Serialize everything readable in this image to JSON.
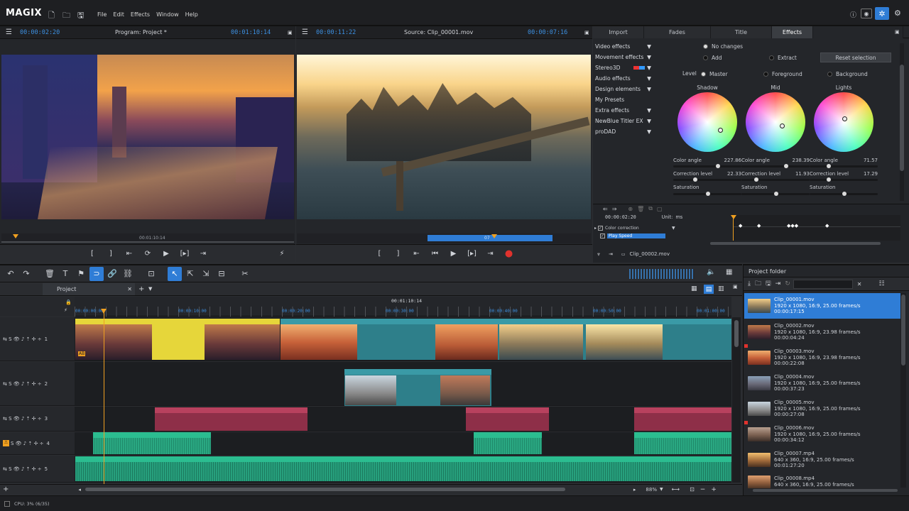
{
  "app": {
    "logo": "MAGIX",
    "menu": [
      "File",
      "Edit",
      "Effects",
      "Window",
      "Help"
    ]
  },
  "program_monitor": {
    "timecode_left": "00:00:02:20",
    "title": "Program: Project *",
    "timecode_right": "00:01:10:14",
    "scrub_time": "00:01:10:14"
  },
  "source_monitor": {
    "timecode_left": "00:00:11:22",
    "title": "Source: Clip_00001.mov",
    "timecode_right": "00:00:07:16",
    "scrub_label": "07"
  },
  "effects_panel": {
    "tabs": [
      "Import",
      "Fades",
      "Title",
      "Effects"
    ],
    "active_tab": "Effects",
    "categories": [
      "Video effects",
      "Movement effects",
      "Stereo3D",
      "Audio effects",
      "Design elements",
      "My Presets",
      "Extra effects",
      "NewBlue Titler EX",
      "proDAD"
    ],
    "options": {
      "no_changes": "No changes",
      "add": "Add",
      "extract": "Extract",
      "reset": "Reset selection",
      "level": "Level",
      "master": "Master",
      "foreground": "Foreground",
      "background": "Background"
    },
    "wheels": [
      {
        "name": "Shadow",
        "angle_label": "Color angle",
        "angle": "227.86",
        "level_label": "Correction level",
        "level": "22.33",
        "sat_label": "Saturation"
      },
      {
        "name": "Mid",
        "angle_label": "Color angle",
        "angle": "238.39",
        "level_label": "Correction level",
        "level": "11.93",
        "sat_label": "Saturation"
      },
      {
        "name": "Lights",
        "angle_label": "Color angle",
        "angle": "71.57",
        "level_label": "Correction level",
        "level": "17.29",
        "sat_label": "Saturation"
      }
    ],
    "keyframe_time": "00:00:02:20",
    "units_label": "Unit:",
    "units_value": "ms",
    "kf_tracks": [
      "Color correction",
      "Play Speed"
    ],
    "clip_name": "Clip_00002.mov"
  },
  "timeline": {
    "tab": "Project",
    "ruler_center": "00:01:10:14",
    "ruler_marks": [
      "00:00:00:00",
      "00:00:10:00",
      "00:00:20:00",
      "00:00:30:00",
      "00:00:40:00",
      "00:00:50:00",
      "00:01:00:00"
    ],
    "zoom": "88%",
    "track_numbers": [
      "1",
      "2",
      "3",
      "4",
      "5"
    ],
    "clips": {
      "t1_yellow": "Clip_00002.mov  75   Color correction",
      "t1_b": "Clip_00003.mov",
      "t1_c": "Clip_00001.mov  75",
      "t2": "Clip_00008.mov",
      "t3_a": "Title   X-pos   Y-pos   Anti cropping",
      "t3_b": "Title   X-pos   Y-pos   Anti ...",
      "t3_c": "Title   X-pos   Y-pos   Anti cropping",
      "t4_a": "Voiceover.wav  75",
      "t4_b": "Voiceover.wav",
      "t4_c": "Voiceover.wav  75",
      "t5": "This Way.wav"
    },
    "clip_badge": "AB"
  },
  "project_folder": {
    "title": "Project folder",
    "items": [
      {
        "name": "Clip_00001.mov",
        "format": "1920 x 1080, 16:9, 25.00 frames/s",
        "duration": "00:00:17:15"
      },
      {
        "name": "Clip_00002.mov",
        "format": "1920 x 1080, 16:9, 23.98 frames/s",
        "duration": "00:00:04:24"
      },
      {
        "name": "Clip_00003.mov",
        "format": "1920 x 1080, 16:9, 23.98 frames/s",
        "duration": "00:00:22:08"
      },
      {
        "name": "Clip_00004.mov",
        "format": "1920 x 1080, 16:9, 25.00 frames/s",
        "duration": "00:00:37:23"
      },
      {
        "name": "Clip_00005.mov",
        "format": "1920 x 1080, 16:9, 25.00 frames/s",
        "duration": "00:00:27:08"
      },
      {
        "name": "Clip_00006.mov",
        "format": "1920 x 1080, 16:9, 25.00 frames/s",
        "duration": "00:00:34:12"
      },
      {
        "name": "Clip_00007.mp4",
        "format": "640 x 360, 16:9, 25.00 frames/s",
        "duration": "00:01:27:20"
      },
      {
        "name": "Clip_00008.mp4",
        "format": "640 x 360, 16:9, 25.00 frames/s",
        "duration": ""
      }
    ]
  },
  "status": {
    "cpu": "CPU: 3% (6/35)"
  },
  "colors": {
    "accent": "#2f7dd6",
    "timecode": "#3c8fe0",
    "clip_teal": "#2e7f8a",
    "clip_yellow": "#e6d63a",
    "title_pink": "#b8415e",
    "audio_green": "#2aa882",
    "record": "#e0322d"
  }
}
